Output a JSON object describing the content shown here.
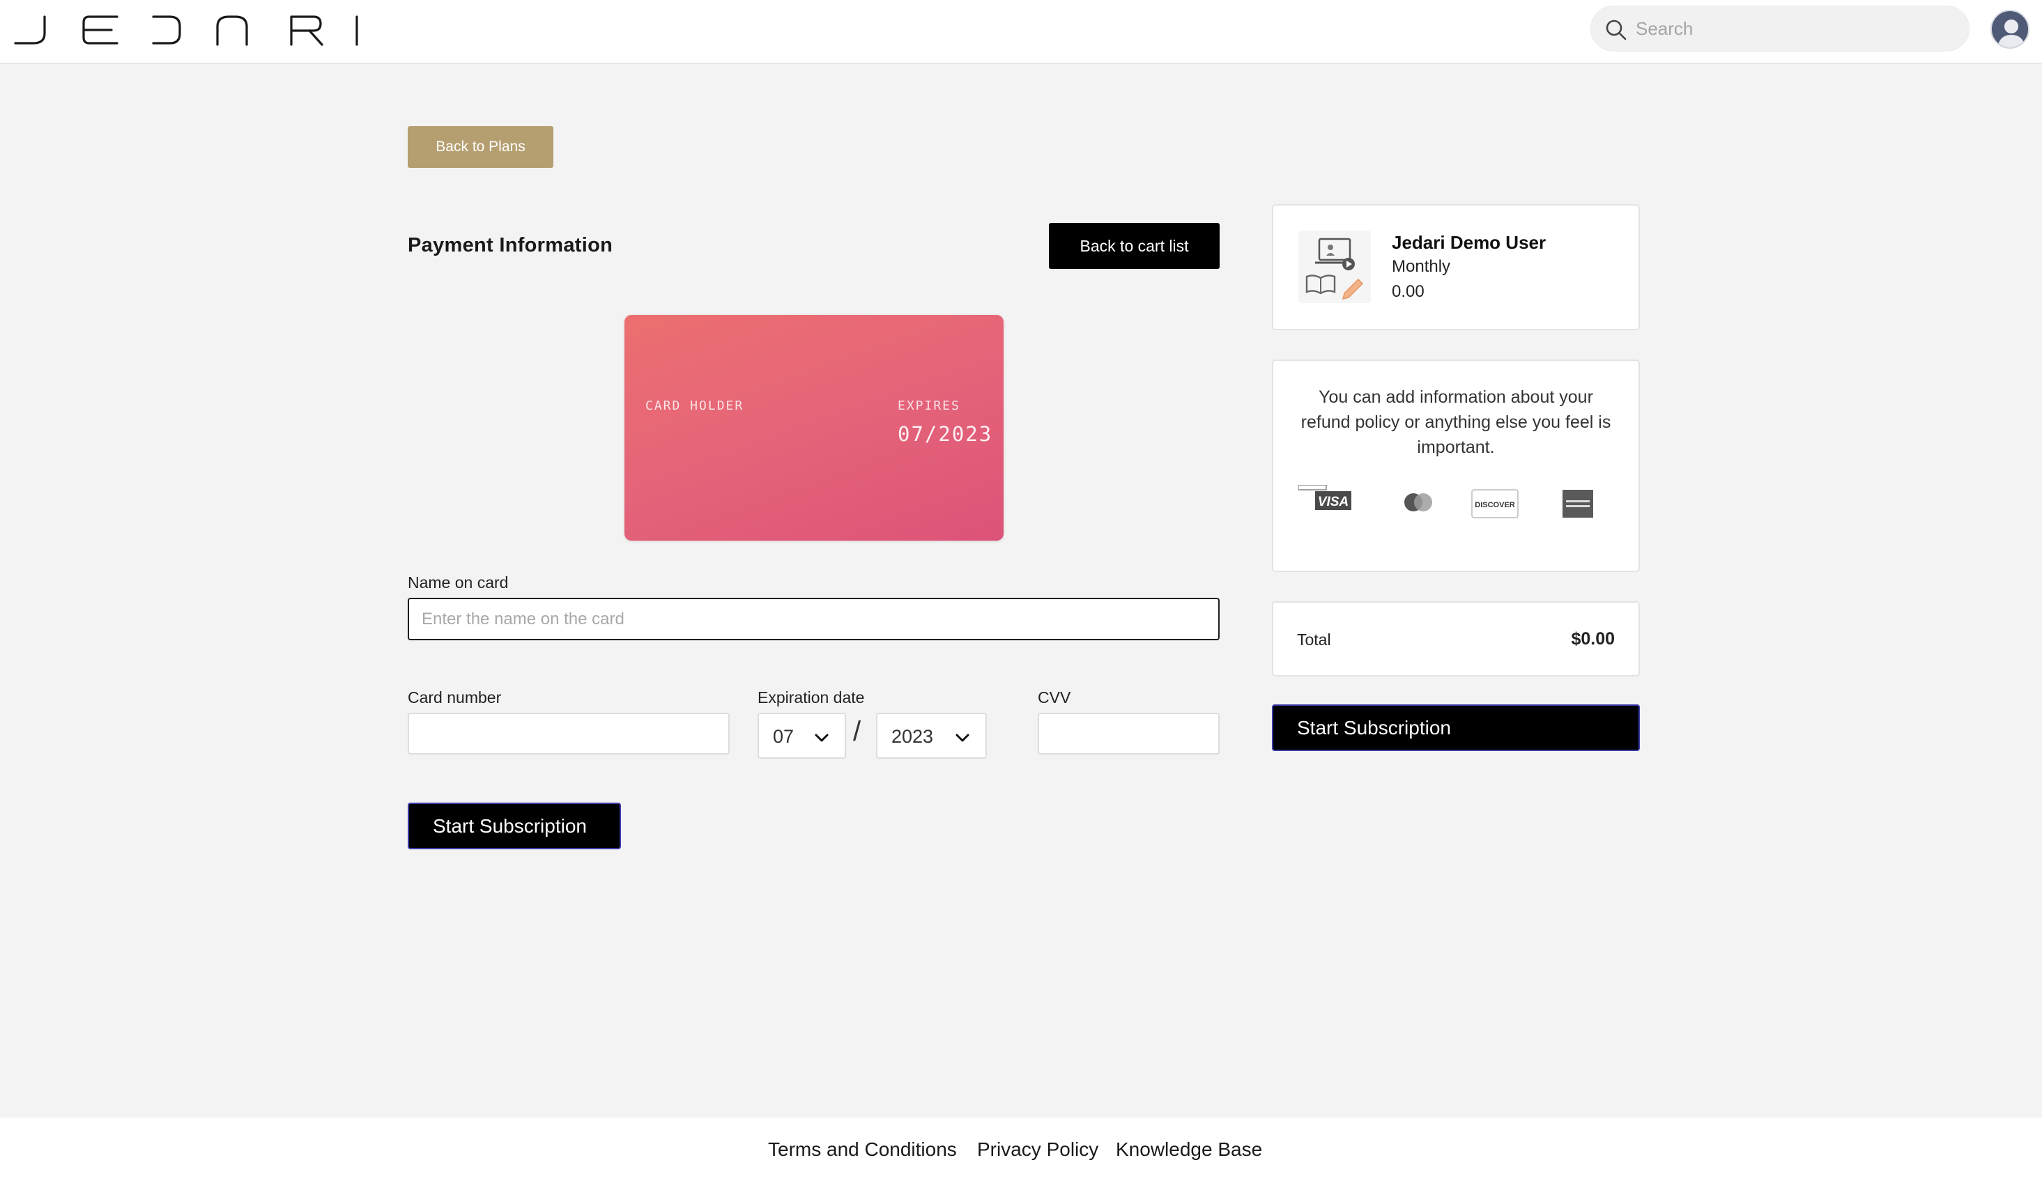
{
  "header": {
    "logo_text": "JEDNRI",
    "search": {
      "placeholder": "Search"
    }
  },
  "back_to_plans_label": "Back to Plans",
  "payment": {
    "title": "Payment Information",
    "back_to_cart_label": "Back to cart list",
    "card_preview": {
      "holder_label": "CARD HOLDER",
      "expires_label": "EXPIRES",
      "expires_value": "07/2023"
    },
    "name_on_card": {
      "label": "Name on card",
      "placeholder": "Enter the name on the card",
      "value": ""
    },
    "card_number": {
      "label": "Card number",
      "value": ""
    },
    "expiration": {
      "label": "Expiration date",
      "month": "07",
      "year": "2023",
      "separator": "/"
    },
    "cvv": {
      "label": "CVV",
      "value": ""
    },
    "submit_label": "Start Subscription"
  },
  "sidebar": {
    "plan": {
      "name": "Jedari Demo User",
      "period": "Monthly",
      "price": "0.00"
    },
    "refund_info": "You can add information about your refund policy or anything else you feel is important.",
    "payment_icons": [
      "visa-icon",
      "mastercard-icon",
      "discover-icon",
      "amex-icon"
    ],
    "payment_icon_texts": {
      "visa": "VISA",
      "discover": "DISCOVER"
    },
    "total": {
      "label": "Total",
      "value": "$0.00"
    },
    "submit_label": "Start Subscription"
  },
  "footer": {
    "links": [
      "Terms and Conditions",
      "Privacy Policy",
      "Knowledge Base"
    ]
  },
  "colors": {
    "gold_button": "#b59f71",
    "card_gradient_start": "#ec6f70",
    "card_gradient_end": "#dc5378",
    "primary_button": "#000000",
    "page_background": "#f3f3f3"
  }
}
